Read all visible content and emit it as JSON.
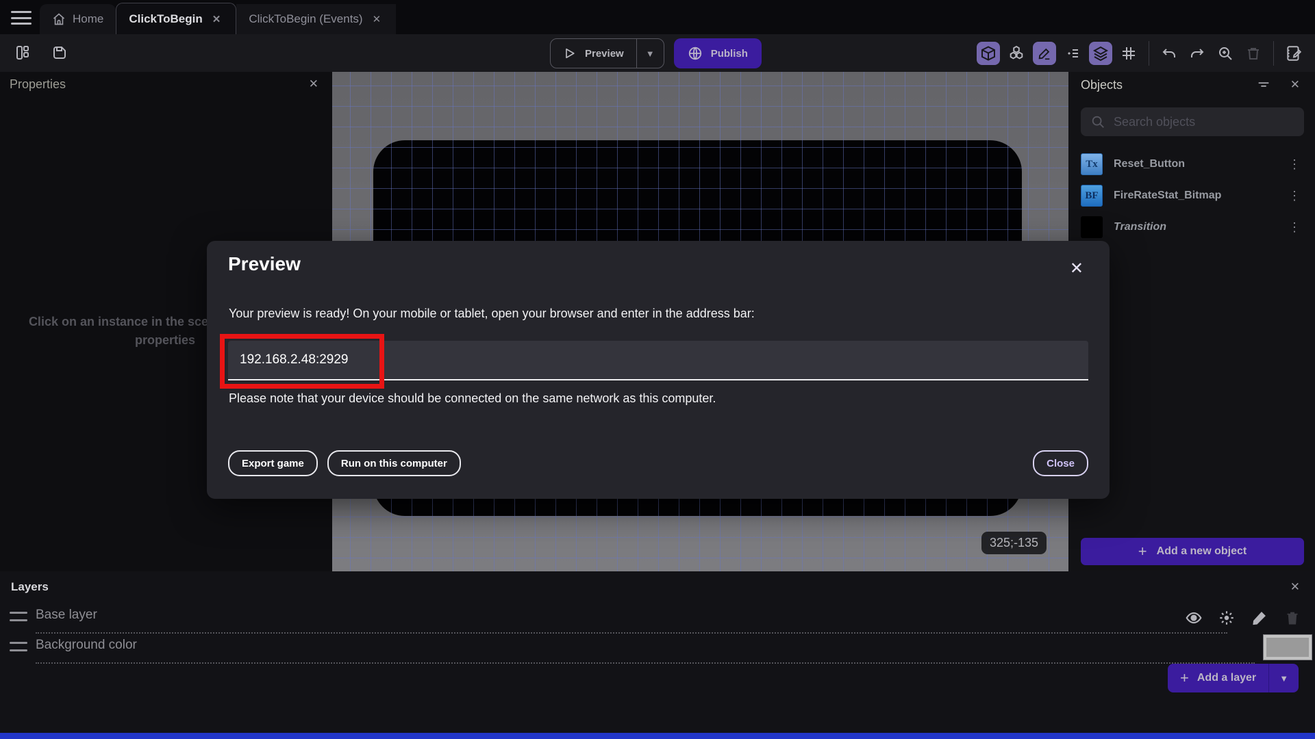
{
  "tabs": {
    "home": "Home",
    "scene": "ClickToBegin",
    "events": "ClickToBegin (Events)",
    "close_glyph": "✕"
  },
  "toolbar": {
    "preview_label": "Preview",
    "publish_label": "Publish",
    "caret_glyph": "▼"
  },
  "properties_panel": {
    "title": "Properties",
    "hint": "Click on an instance in the scene to display its properties"
  },
  "canvas": {
    "cursor_position": "325;-135"
  },
  "objects_panel": {
    "title": "Objects",
    "search_placeholder": "Search objects",
    "items": [
      {
        "name": "Reset_Button",
        "icon_label": "Tx"
      },
      {
        "name": "FireRateStat_Bitmap",
        "icon_label": "BF"
      },
      {
        "name": "Transition",
        "icon_label": ""
      }
    ],
    "menu_glyph": "⋮",
    "add_button_label": "Add a new object",
    "plus_glyph": "+"
  },
  "layers_panel": {
    "title": "Layers",
    "layers": [
      {
        "name": "Base layer"
      },
      {
        "name": "Background color"
      }
    ],
    "add_button_label": "Add a layer",
    "plus_glyph": "+",
    "caret_glyph": "▼"
  },
  "modal": {
    "title": "Preview",
    "close_glyph": "✕",
    "message": "Your preview is ready! On your mobile or tablet, open your browser and enter in the address bar:",
    "address": "192.168.2.48:2929",
    "note": "Please note that your device should be connected on the same network as this computer.",
    "buttons": {
      "export": "Export game",
      "run": "Run on this computer",
      "close": "Close"
    }
  },
  "colors": {
    "accent_purple": "#3b1c9e",
    "active_icon_purple": "#7568ae",
    "annotation_red": "#e81414",
    "canvas_gray": "#707074",
    "grid_blue": "#6776c4",
    "bottom_strip_blue": "#2236c8"
  }
}
